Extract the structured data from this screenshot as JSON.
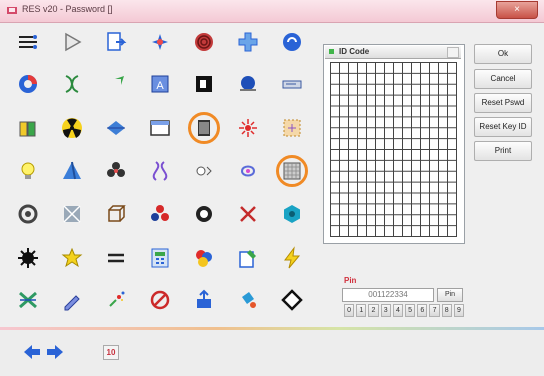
{
  "window": {
    "title": "RES v20 - Password []",
    "close_label": "×"
  },
  "id_panel": {
    "header_label": "ID Code"
  },
  "buttons": {
    "ok": "Ok",
    "cancel": "Cancel",
    "reset_pswd": "Reset Pswd",
    "reset_key_id": "Reset Key ID",
    "print": "Print"
  },
  "pin": {
    "label": "Pin",
    "value": "001122334",
    "button_label": "Pin",
    "digits": [
      "0",
      "1",
      "2",
      "3",
      "4",
      "5",
      "6",
      "7",
      "8",
      "9"
    ]
  },
  "footer": {
    "page_number": "10"
  },
  "icons": [
    [
      "cable-icon",
      "play-triangle-icon",
      "document-arrow-icon",
      "blue-star-spark-icon",
      "red-rose-spiral-icon",
      "blue-plus-cross-icon",
      "blue-swirl-globe-icon"
    ],
    [
      "blue-donut-icon",
      "dna-spiral-icon",
      "green-arrow-icon",
      "blue-book-icon",
      "black-square-frame-icon",
      "blue-sphere-icon",
      "device-strip-icon"
    ],
    [
      "yellow-cube-stack-icon",
      "radiation-icon",
      "blue-gem-icon",
      "window-frame-icon",
      "barcode-frame-icon",
      "red-burst-icon",
      "dotted-box-icon"
    ],
    [
      "lightbulb-icon",
      "blue-pyramid-icon",
      "dark-flower-icon",
      "dna-helix-icon",
      "eye-toggle-icon",
      "curly-knot-icon",
      "grid-square-icon"
    ],
    [
      "gear-ring-icon",
      "pattern-tile-icon",
      "wire-cube-icon",
      "red-ball-cluster-icon",
      "white-flower-icon",
      "red-x-icon",
      "teal-hexagon-icon"
    ],
    [
      "black-splat-icon",
      "yellow-star-icon",
      "equals-icon",
      "calculator-icon",
      "color-orbs-icon",
      "document-pen-icon",
      "lightning-icon"
    ],
    [
      "green-x-brush-icon",
      "pen-icon",
      "sparkle-tool-icon",
      "no-entry-icon",
      "upload-box-icon",
      "paint-bucket-icon",
      "diamond-outline-icon"
    ]
  ],
  "colors": {
    "selection_ring": "#f08a25",
    "pin_label": "#d1303d",
    "nav_arrow": "#2a63d6",
    "title_bar": "#f4c9d4"
  }
}
